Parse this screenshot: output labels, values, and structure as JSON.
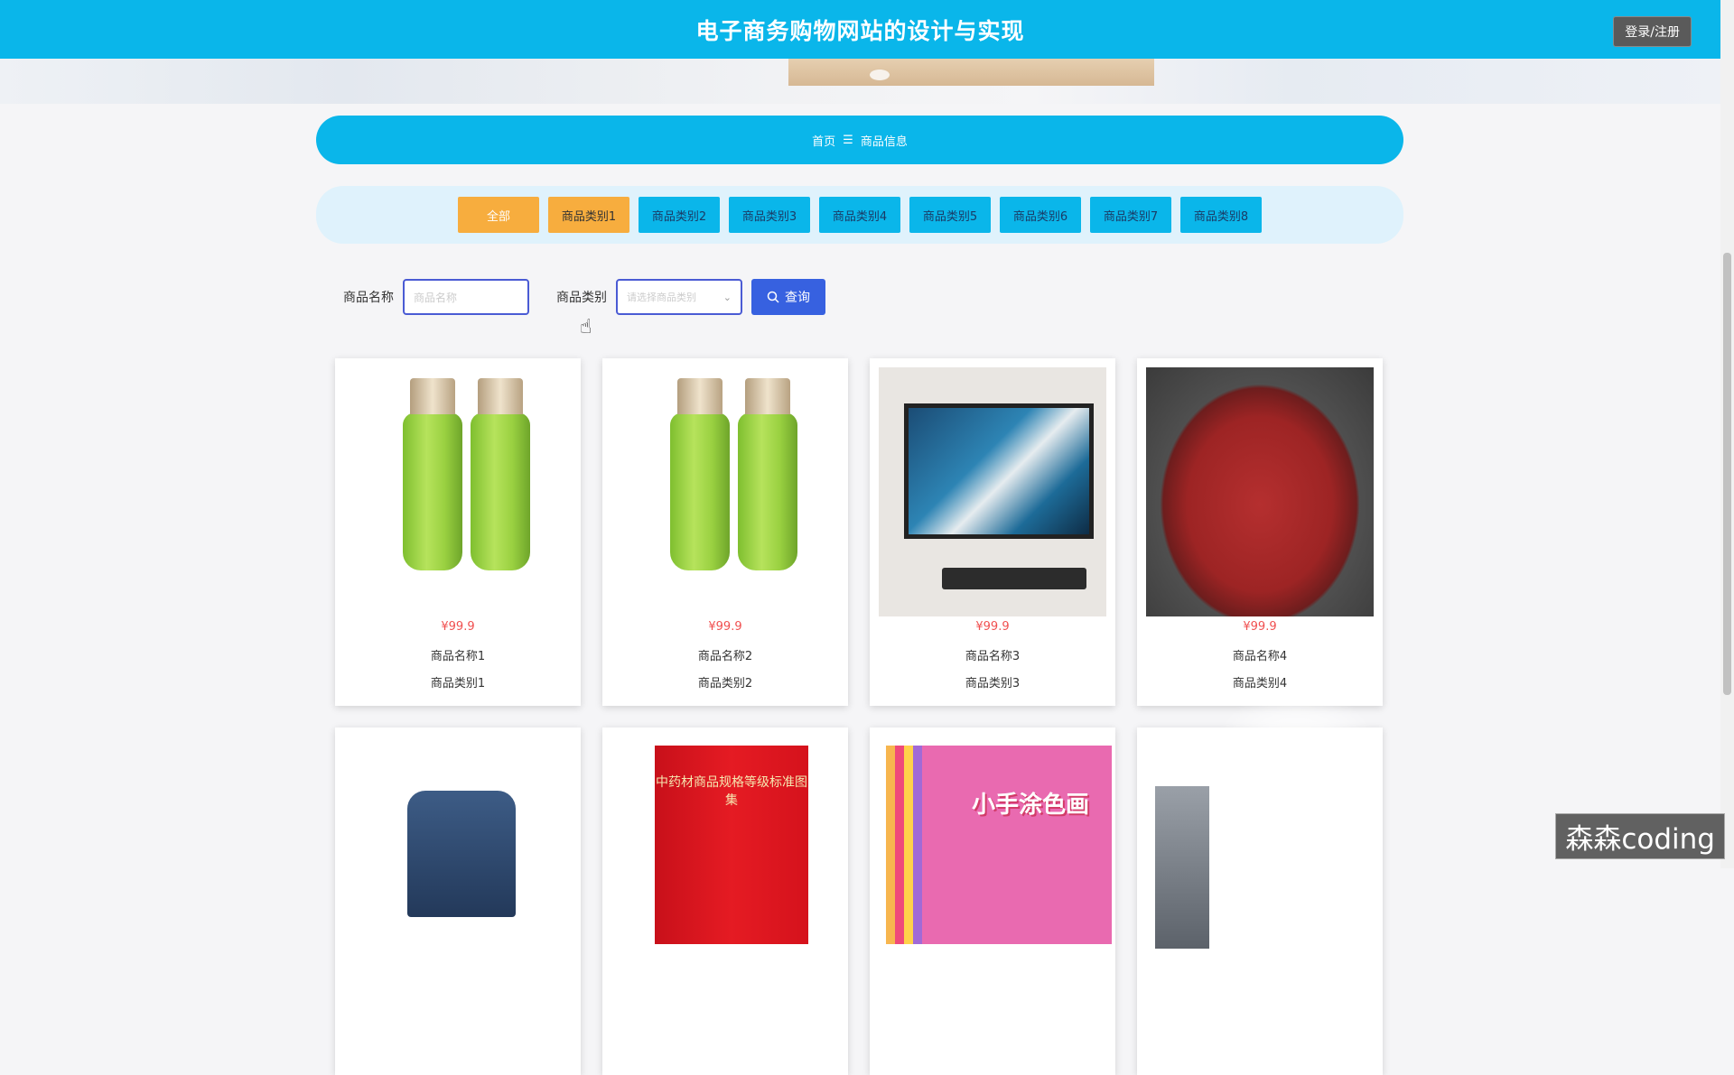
{
  "header": {
    "title": "电子商务购物网站的设计与实现",
    "login_label": "登录/注册",
    "accent_color": "#0ab6ea"
  },
  "breadcrumb": {
    "home": "首页",
    "separator": "☰",
    "current": "商品信息"
  },
  "categories": [
    {
      "label": "全部"
    },
    {
      "label": "商品类别1"
    },
    {
      "label": "商品类别2"
    },
    {
      "label": "商品类别3"
    },
    {
      "label": "商品类别4"
    },
    {
      "label": "商品类别5"
    },
    {
      "label": "商品类别6"
    },
    {
      "label": "商品类别7"
    },
    {
      "label": "商品类别8"
    }
  ],
  "search": {
    "name_label": "商品名称",
    "name_placeholder": "商品名称",
    "category_label": "商品类别",
    "category_placeholder": "请选择商品类别",
    "button_label": "查询"
  },
  "products": [
    {
      "price": "¥99.9",
      "name": "商品名称1",
      "category": "商品类别1",
      "image": "green-bottles"
    },
    {
      "price": "¥99.9",
      "name": "商品名称2",
      "category": "商品类别2",
      "image": "green-bottles"
    },
    {
      "price": "¥99.9",
      "name": "商品名称3",
      "category": "商品类别3",
      "image": "computer-monitor"
    },
    {
      "price": "¥99.9",
      "name": "商品名称4",
      "category": "商品类别4",
      "image": "raw-beef"
    },
    {
      "image": "denim-jacket"
    },
    {
      "image": "red-book",
      "cover_text": "中药材商品规格等级标准图集"
    },
    {
      "image": "coloring-book",
      "cover_text": "小手涂色画"
    },
    {
      "image": "refrigerator"
    }
  ],
  "watermark": "森森coding"
}
